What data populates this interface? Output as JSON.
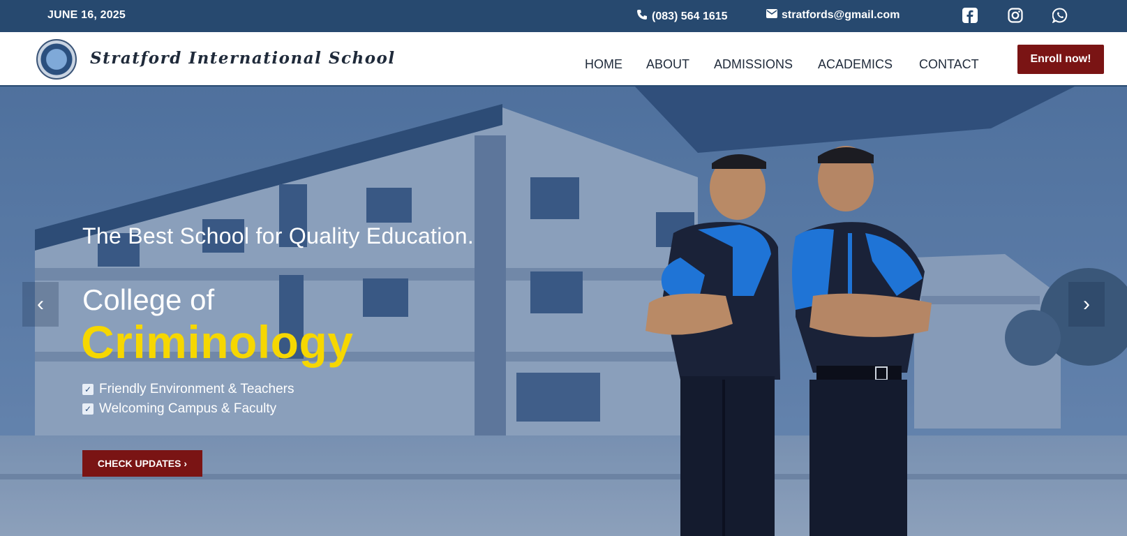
{
  "topbar": {
    "date": "JUNE 16, 2025",
    "phone": "(083) 564 1615",
    "email": "stratfords@gmail.com",
    "social_icons": [
      "facebook-icon",
      "instagram-icon",
      "whatsapp-icon"
    ]
  },
  "navbar": {
    "school_name": "Stratford International School",
    "links": [
      "HOME",
      "ABOUT",
      "ADMISSIONS",
      "ACADEMICS",
      "CONTACT"
    ],
    "enroll_label": "Enroll now!"
  },
  "hero": {
    "tagline": "The Best School for Quality Education.",
    "college_prefix": "College of",
    "program": "Criminology",
    "features": [
      "Friendly Environment & Teachers",
      "Welcoming Campus & Faculty"
    ],
    "cta_label": "CHECK UPDATES",
    "cta_icon": "chevron-right-icon",
    "prev_icon": "chevron-left-icon",
    "next_icon": "chevron-right-icon"
  },
  "colors": {
    "topbar_bg": "#27496f",
    "button_red": "#7a1414",
    "accent_yellow": "#f6d700",
    "hero_overlay": "#2a4f7e"
  }
}
